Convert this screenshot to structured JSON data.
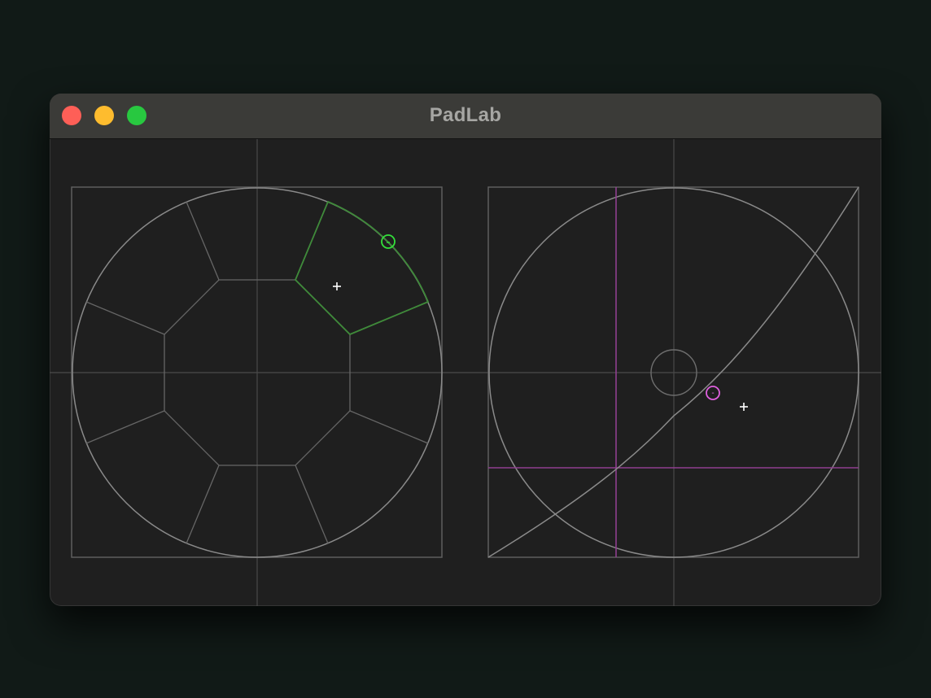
{
  "window": {
    "title": "PadLab",
    "controls": [
      "close",
      "minimize",
      "zoom"
    ]
  },
  "colors": {
    "background": "#111a17",
    "window": "#1f1f1f",
    "titlebar": "#3b3b38",
    "grid": "#4a4a4a",
    "outline": "#8a8a8a",
    "active_segment": "#3f8a3a",
    "left_cursor": "#33e03a",
    "right_cursor": "#e060e0",
    "threshold_lines": "#8f3f8f",
    "pointer": "#ffffff"
  },
  "left_pad": {
    "type": "radial-segmented-pad",
    "segment_count": 8,
    "active_segment": 1,
    "cursor_icon": "green-ring-cursor",
    "pointer_icon": "crosshair-plus-icon"
  },
  "right_pad": {
    "type": "xy-curve-pad",
    "cursor_icon": "magenta-ring-cursor",
    "cursor_label": "-",
    "pointer_icon": "crosshair-plus-icon"
  }
}
